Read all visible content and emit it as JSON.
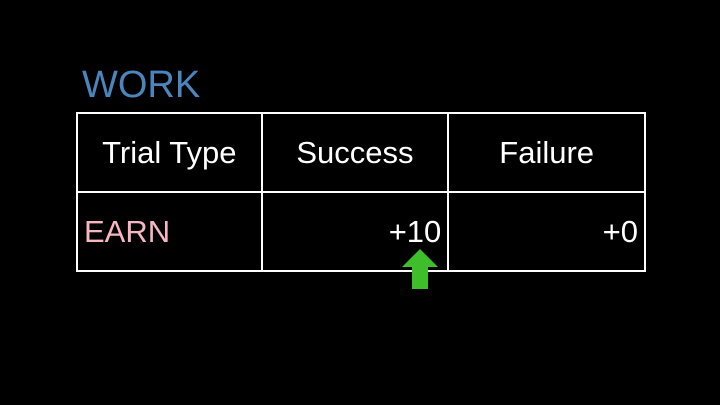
{
  "title": "WORK",
  "colors": {
    "background": "#000000",
    "title": "#4a86bd",
    "row_label": "#f7b6c2",
    "grid_lines": "#ffffff",
    "arrow": "#3fbe2c"
  },
  "table": {
    "headers": [
      "Trial Type",
      "Success",
      "Failure"
    ],
    "rows": [
      {
        "label": "EARN",
        "success": "+10",
        "failure": "+0"
      }
    ]
  },
  "indicator": {
    "icon": "up-arrow-icon",
    "column": "Success"
  }
}
